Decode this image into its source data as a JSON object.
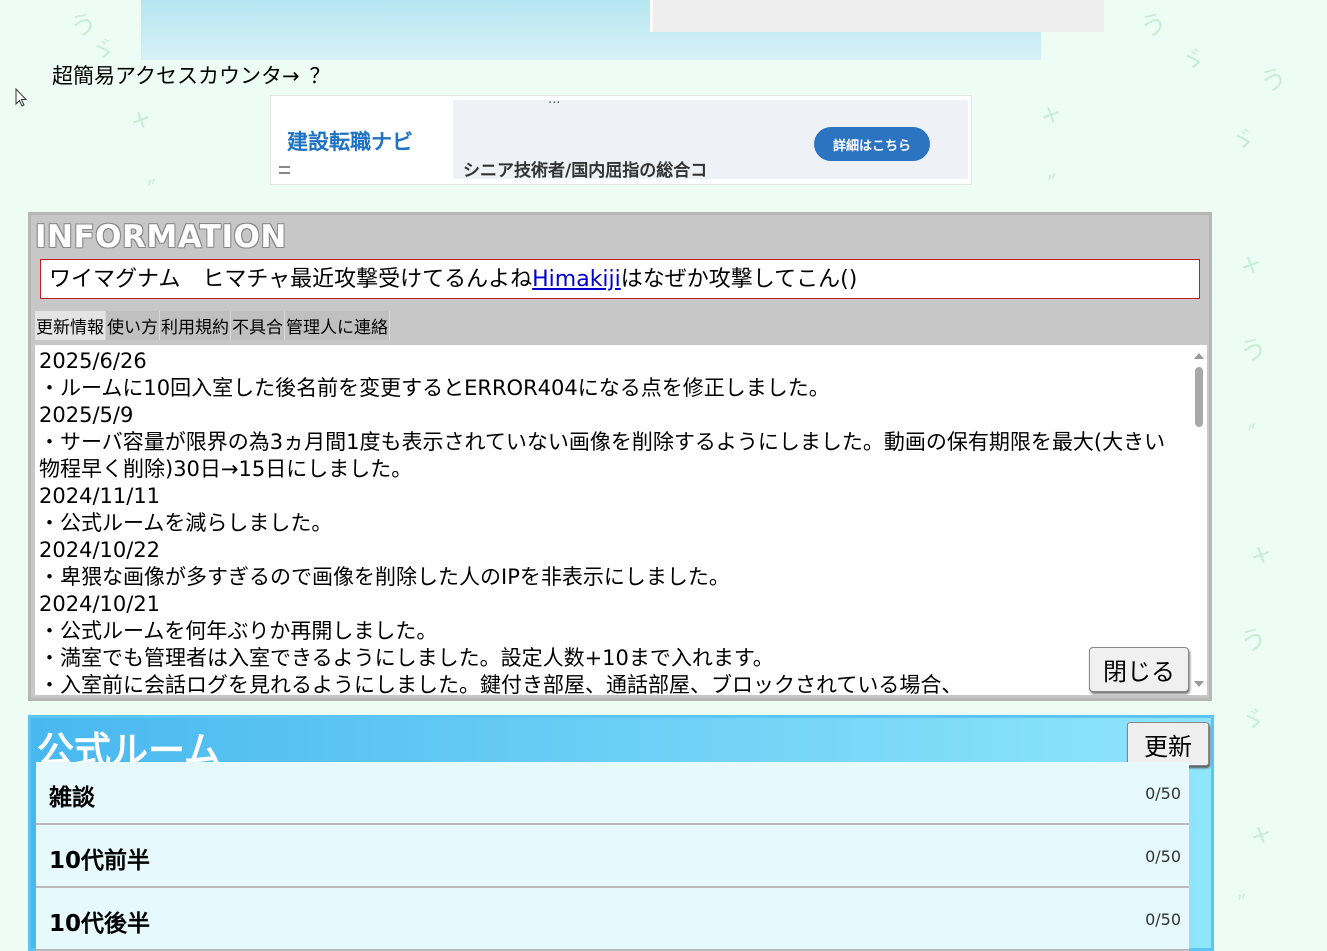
{
  "colors": {
    "info_border": "#b6b6b6",
    "notice_border": "#c21c1c",
    "link": "#0000cc",
    "rooms_header": "#48b8f0",
    "ad_brand": "#1d72c2"
  },
  "counter": {
    "label": "超簡易アクセスカウンタ→",
    "value": "？"
  },
  "ad": {
    "logo": "建設転職ナビ",
    "partial_text": "...",
    "text": "シニア技術者/国内屈指の総合コ",
    "cta": "詳細はこちら",
    "menu_icon": "menu-icon"
  },
  "information": {
    "title": "INFORMATION",
    "notice_prefix": "ワイマグナム　ヒマチャ最近攻撃受けてるんよね",
    "notice_link": "Himakiji",
    "notice_suffix": "はなぜか攻撃してこん()",
    "tabs": [
      {
        "label": "更新情報"
      },
      {
        "label": "使い方"
      },
      {
        "label": "利用規約"
      },
      {
        "label": "不具合"
      },
      {
        "label": "管理人に連絡"
      }
    ],
    "log": [
      "2025/6/26",
      "・ルームに10回入室した後名前を変更するとERROR404になる点を修正しました。",
      "2025/5/9",
      "・サーバ容量が限界の為3ヵ月間1度も表示されていない画像を削除するようにしました。動画の保有期限を最大(大きい物程早く削除)30日→15日にしました。",
      "2024/11/11",
      "・公式ルームを減らしました。",
      "2024/10/22",
      "・卑猥な画像が多すぎるので画像を削除した人のIPを非表示にしました。",
      "2024/10/21",
      "・公式ルームを何年ぶりか再開しました。",
      "・満室でも管理者は入室できるようにしました。設定人数+10まで入れます。",
      "・入室前に会話ログを見れるようにしました。鍵付き部屋、通話部屋、ブロックされている場合、"
    ],
    "close_button": "閉じる"
  },
  "rooms": {
    "title": "公式ルーム",
    "refresh_button": "更新",
    "items": [
      {
        "name": "雑談",
        "count": "0/50"
      },
      {
        "name": "10代前半",
        "count": "0/50"
      },
      {
        "name": "10代後半",
        "count": "0/50"
      }
    ]
  }
}
